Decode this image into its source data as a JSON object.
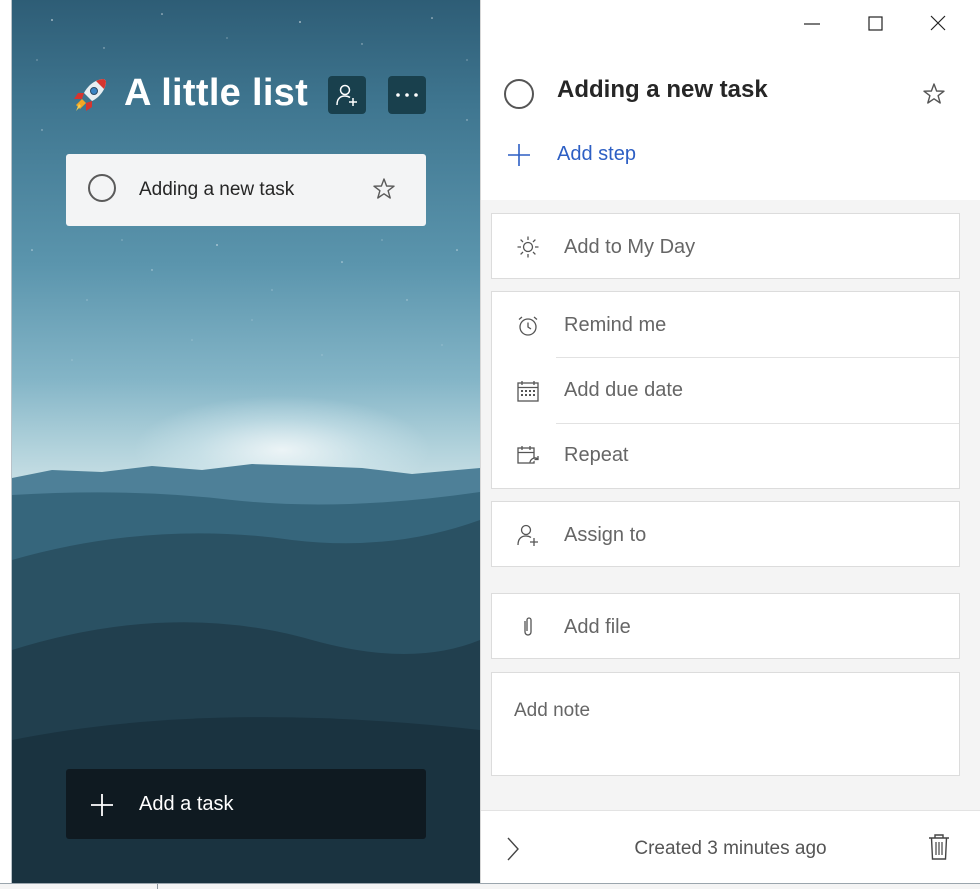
{
  "list": {
    "emoji_icon": "rocket-icon",
    "title": "A little list",
    "share_icon": "person-add-icon",
    "more_icon": "more-icon"
  },
  "tasks": [
    {
      "title": "Adding a new task",
      "completed": false,
      "important": false
    }
  ],
  "add_task": {
    "label": "Add a task"
  },
  "window_controls": [
    "minimize",
    "maximize",
    "close"
  ],
  "detail": {
    "title": "Adding a new task",
    "add_step_label": "Add step",
    "my_day_label": "Add to My Day",
    "remind_label": "Remind me",
    "due_date_label": "Add due date",
    "repeat_label": "Repeat",
    "assign_label": "Assign to",
    "file_label": "Add file",
    "note_placeholder": "Add note",
    "created_text": "Created 3 minutes ago"
  },
  "colors": {
    "accent": "#2d5fc4",
    "header_button_bg": "#19404d",
    "add_task_bg": "#0f1a21",
    "panel_bg": "#f4f4f4"
  }
}
